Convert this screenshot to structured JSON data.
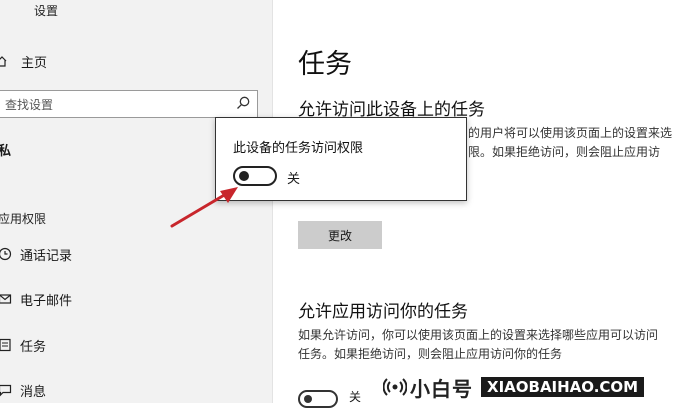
{
  "app": {
    "title": "设置"
  },
  "sidebar": {
    "home": {
      "label": "主页",
      "icon": "home-icon"
    },
    "search": {
      "placeholder": "查找设置",
      "icon": "search-icon"
    },
    "section_privacy": "私",
    "section_permissions": "应用权限",
    "items": [
      {
        "label": "通话记录",
        "icon": "call-history-icon"
      },
      {
        "label": "电子邮件",
        "icon": "email-icon"
      },
      {
        "label": "任务",
        "icon": "tasks-icon"
      },
      {
        "label": "消息",
        "icon": "message-icon"
      }
    ]
  },
  "main": {
    "title": "任务",
    "section1": {
      "heading": "允许访问此设备上的任务",
      "desc_line1": "的用户将可以使用该页面上的设置来选",
      "desc_line2": "限。如果拒绝访问，则会阻止应用访",
      "button_label": "更改"
    },
    "section2": {
      "heading": "允许应用访问你的任务",
      "desc_line1": "如果允许访问，你可以使用该页面上的设置来选择哪些应用可以访问",
      "desc_line2": "任务。如果拒绝访问，则会阻止应用访问你的任务",
      "toggle_label": "关"
    }
  },
  "dialog": {
    "title": "此设备的任务访问权限",
    "toggle_state_label": "关"
  },
  "watermark": {
    "logo_text": "小白号",
    "logo_domain": "XIAOBAIHAO.COM"
  },
  "colors": {
    "arrow": "#c8262c",
    "sidebar_bg": "#f2f2f2",
    "button_bg": "#cccccc"
  }
}
